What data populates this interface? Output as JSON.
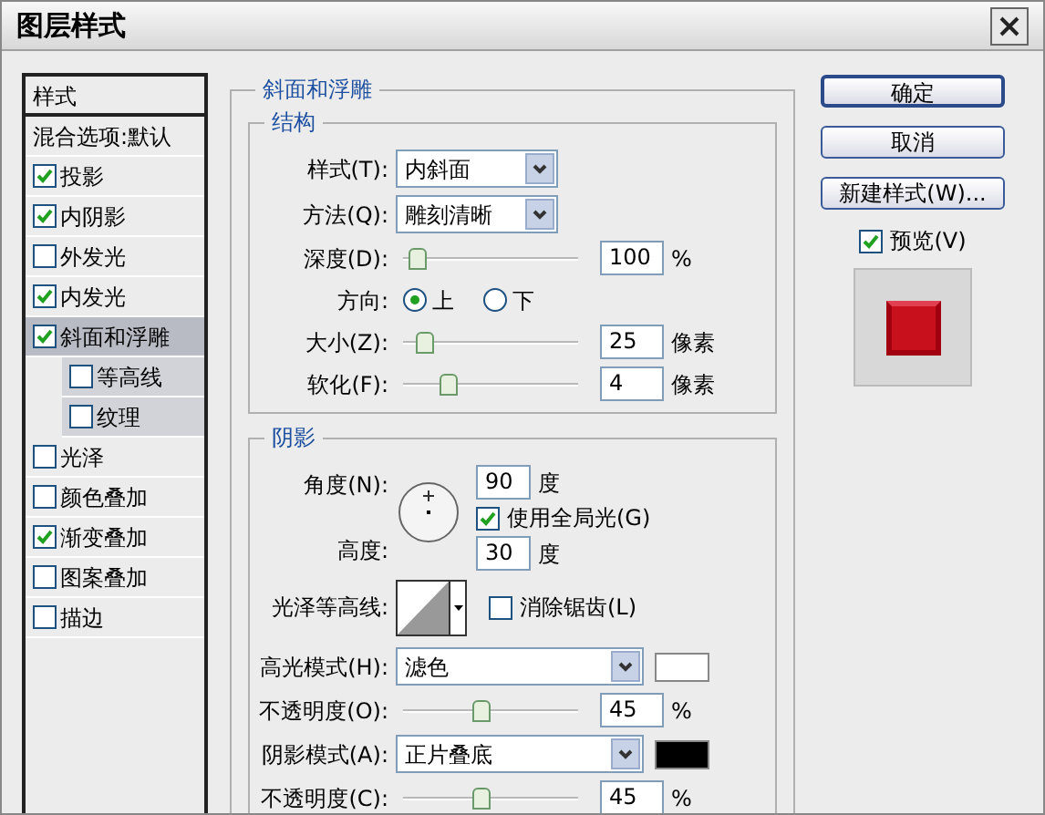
{
  "window": {
    "title": "图层样式"
  },
  "sidebar": {
    "header": "样式",
    "items": [
      {
        "label": "混合选项:默认",
        "kind": "option",
        "selected": false
      },
      {
        "label": "投影",
        "kind": "effect",
        "checked": true,
        "selected": false
      },
      {
        "label": "内阴影",
        "kind": "effect",
        "checked": true,
        "selected": false
      },
      {
        "label": "外发光",
        "kind": "effect",
        "checked": false,
        "selected": false
      },
      {
        "label": "内发光",
        "kind": "effect",
        "checked": true,
        "selected": false
      },
      {
        "label": "斜面和浮雕",
        "kind": "effect",
        "checked": true,
        "selected": true,
        "children": [
          {
            "label": "等高线",
            "checked": false,
            "selected": false
          },
          {
            "label": "纹理",
            "checked": false,
            "selected": false
          }
        ]
      },
      {
        "label": "光泽",
        "kind": "effect",
        "checked": false,
        "selected": false
      },
      {
        "label": "颜色叠加",
        "kind": "effect",
        "checked": false,
        "selected": false
      },
      {
        "label": "渐变叠加",
        "kind": "effect",
        "checked": true,
        "selected": false
      },
      {
        "label": "图案叠加",
        "kind": "effect",
        "checked": false,
        "selected": false
      },
      {
        "label": "描边",
        "kind": "effect",
        "checked": false,
        "selected": false
      }
    ]
  },
  "panel": {
    "title": "斜面和浮雕",
    "structure": {
      "title": "结构",
      "style": {
        "label": "样式(T):",
        "value": "内斜面"
      },
      "technique": {
        "label": "方法(Q):",
        "value": "雕刻清晰"
      },
      "depth": {
        "label": "深度(D):",
        "level": 0.08,
        "value": "100",
        "unit": "%"
      },
      "direction": {
        "label": "方向:",
        "options": [
          {
            "label": "上",
            "selected": true
          },
          {
            "label": "下",
            "selected": false
          }
        ]
      },
      "size": {
        "label": "大小(Z):",
        "level": 0.13,
        "value": "25",
        "unit": "像素"
      },
      "soften": {
        "label": "软化(F):",
        "level": 0.26,
        "value": "4",
        "unit": "像素"
      }
    },
    "shading": {
      "title": "阴影",
      "angle": {
        "label": "角度(N):",
        "value": "90",
        "unit": "度"
      },
      "global_light": {
        "label": "使用全局光(G)",
        "checked": true
      },
      "altitude": {
        "label": "高度:",
        "value": "30",
        "unit": "度"
      },
      "gloss_contour": {
        "label": "光泽等高线:"
      },
      "anti_aliased": {
        "label": "消除锯齿(L)",
        "checked": false
      },
      "highlight_mode": {
        "label": "高光模式(H):",
        "value": "滤色",
        "color": "#ffffff"
      },
      "highlight_opacity": {
        "label": "不透明度(O):",
        "level": 0.45,
        "value": "45",
        "unit": "%"
      },
      "shadow_mode": {
        "label": "阴影模式(A):",
        "value": "正片叠底",
        "color": "#000000"
      },
      "shadow_opacity": {
        "label": "不透明度(C):",
        "level": 0.45,
        "value": "45",
        "unit": "%"
      }
    }
  },
  "buttons": [
    {
      "label": "确定",
      "default": true
    },
    {
      "label": "取消",
      "default": false
    },
    {
      "label": "新建样式(W)...",
      "default": false
    }
  ],
  "preview": {
    "label": "预览(V)",
    "checked": true
  }
}
